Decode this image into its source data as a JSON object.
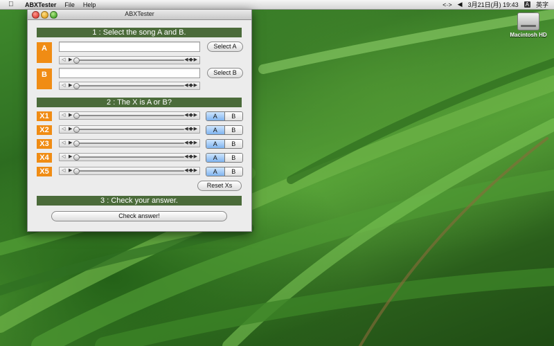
{
  "menubar": {
    "app_name": "ABXTester",
    "menus": [
      "File",
      "Help"
    ],
    "date_time": "3月21日(月)  19:43",
    "input_method": "A",
    "input_method_label": "英字"
  },
  "desktop": {
    "drive_label": "Macintosh HD"
  },
  "window": {
    "title": "ABXTester",
    "section1_title": "1 : Select the song A and B.",
    "song_a": {
      "label": "A",
      "path": "",
      "button": "Select A"
    },
    "song_b": {
      "label": "B",
      "path": "",
      "button": "Select B"
    },
    "section2_title": "2 : The X is A or B?",
    "xs": [
      {
        "label": "X1",
        "option_a": "A",
        "option_b": "B",
        "selected": "A"
      },
      {
        "label": "X2",
        "option_a": "A",
        "option_b": "B",
        "selected": "A"
      },
      {
        "label": "X3",
        "option_a": "A",
        "option_b": "B",
        "selected": "A"
      },
      {
        "label": "X4",
        "option_a": "A",
        "option_b": "B",
        "selected": "A"
      },
      {
        "label": "X5",
        "option_a": "A",
        "option_b": "B",
        "selected": "A"
      }
    ],
    "reset_button": "Reset Xs",
    "section3_title": "3 : Check your answer.",
    "check_button": "Check answer!"
  },
  "colors": {
    "section_bar": "#4b6b3a",
    "label_orange": "#f08c14",
    "segment_selected": "#7fb4ef"
  }
}
